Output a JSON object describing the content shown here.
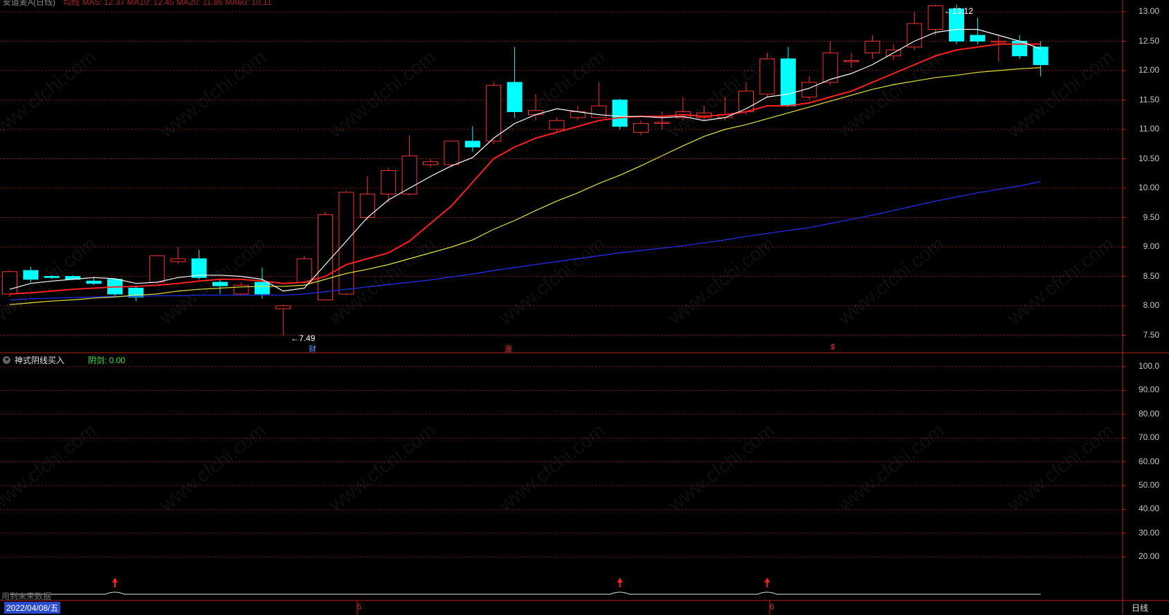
{
  "header": {
    "title": "安道麦A(日线)",
    "ma_legend": "均线   MA5: 12.37  MA10: 12.45  MA20: 11.86  MA60: 10.11"
  },
  "price_axis": {
    "ticks": [
      "13.00",
      "12.50",
      "12.00",
      "11.50",
      "11.00",
      "10.50",
      "10.00",
      "9.50",
      "9.00",
      "8.50",
      "8.00",
      "7.50"
    ],
    "min": 7.2,
    "max": 13.2
  },
  "indicator": {
    "name": "神式阴线买入",
    "value_label": "阴剑: 0.00",
    "axis_ticks": [
      "100.0",
      "90.00",
      "80.00",
      "70.00",
      "60.00",
      "50.00",
      "40.00",
      "30.00",
      "20.00"
    ],
    "future_note": "用到未来数据"
  },
  "extremes": {
    "high": "13.12",
    "low": "7.49"
  },
  "event_markers": [
    {
      "label": "财",
      "color": "#4aa0ff"
    },
    {
      "label": "涨",
      "color": "#ff3030"
    },
    {
      "label": "$",
      "color": "#ff3030"
    }
  ],
  "footer": {
    "date": "2022/04/08/五",
    "month_ticks": [
      "5",
      "6"
    ],
    "period": "日线"
  },
  "watermark": "www.cfchi.com",
  "colors": {
    "up": "#ff3030",
    "down": "#00ffff",
    "ma5": "#ffffff",
    "ma10": "#ff2020",
    "ma20": "#e6e63a",
    "ma60": "#2030ff",
    "grid": "#8b1010"
  },
  "chart_data": {
    "type": "candlestick",
    "ohlc": [
      [
        8.2,
        8.6,
        8.58,
        8.15
      ],
      [
        8.6,
        8.66,
        8.45,
        8.4
      ],
      [
        8.5,
        8.52,
        8.48,
        8.46
      ],
      [
        8.5,
        8.52,
        8.45,
        8.44
      ],
      [
        8.42,
        8.48,
        8.38,
        8.35
      ],
      [
        8.45,
        8.46,
        8.2,
        8.15
      ],
      [
        8.3,
        8.32,
        8.15,
        8.08
      ],
      [
        8.4,
        8.85,
        8.85,
        8.38
      ],
      [
        8.75,
        9.0,
        8.8,
        8.72
      ],
      [
        8.8,
        8.95,
        8.48,
        8.45
      ],
      [
        8.4,
        8.45,
        8.34,
        8.2
      ],
      [
        8.2,
        8.4,
        8.35,
        8.18
      ],
      [
        8.4,
        8.65,
        8.2,
        8.12
      ],
      [
        7.95,
        8.02,
        8.0,
        7.49
      ],
      [
        8.4,
        8.85,
        8.8,
        8.38
      ],
      [
        8.1,
        9.6,
        9.55,
        8.1
      ],
      [
        8.2,
        9.95,
        9.93,
        8.18
      ],
      [
        9.5,
        10.2,
        9.9,
        9.45
      ],
      [
        9.9,
        10.35,
        10.3,
        9.75
      ],
      [
        9.9,
        10.9,
        10.55,
        9.88
      ],
      [
        10.4,
        10.5,
        10.45,
        10.35
      ],
      [
        10.4,
        10.8,
        10.8,
        10.35
      ],
      [
        10.8,
        11.05,
        10.7,
        10.62
      ],
      [
        10.8,
        11.8,
        11.75,
        10.75
      ],
      [
        11.8,
        12.4,
        11.3,
        11.2
      ],
      [
        11.25,
        11.6,
        11.32,
        11.15
      ],
      [
        11.0,
        11.2,
        11.15,
        10.95
      ],
      [
        11.2,
        11.4,
        11.3,
        11.15
      ],
      [
        11.2,
        11.8,
        11.4,
        11.2
      ],
      [
        11.5,
        11.52,
        11.05,
        11.0
      ],
      [
        10.95,
        11.15,
        11.1,
        10.9
      ],
      [
        11.1,
        11.3,
        11.12,
        11.0
      ],
      [
        11.2,
        11.55,
        11.3,
        11.15
      ],
      [
        11.2,
        11.4,
        11.28,
        11.15
      ],
      [
        11.2,
        11.55,
        11.25,
        11.15
      ],
      [
        11.3,
        11.8,
        11.65,
        11.25
      ],
      [
        11.6,
        12.3,
        12.2,
        11.55
      ],
      [
        12.2,
        12.4,
        11.4,
        11.38
      ],
      [
        11.55,
        11.9,
        11.8,
        11.5
      ],
      [
        11.8,
        12.5,
        12.3,
        11.75
      ],
      [
        12.15,
        12.3,
        12.17,
        12.05
      ],
      [
        12.3,
        12.6,
        12.5,
        12.2
      ],
      [
        12.25,
        12.45,
        12.35,
        12.18
      ],
      [
        12.4,
        13.0,
        12.8,
        12.35
      ],
      [
        12.7,
        13.12,
        13.1,
        12.6
      ],
      [
        13.05,
        13.12,
        12.5,
        12.45
      ],
      [
        12.6,
        12.9,
        12.5,
        12.45
      ],
      [
        12.5,
        12.6,
        12.5,
        12.15
      ],
      [
        12.5,
        12.6,
        12.25,
        12.2
      ],
      [
        12.4,
        12.5,
        12.1,
        11.9
      ]
    ],
    "ma5": [
      8.28,
      8.38,
      8.42,
      8.45,
      8.48,
      8.46,
      8.38,
      8.4,
      8.48,
      8.52,
      8.52,
      8.5,
      8.45,
      8.25,
      8.3,
      8.7,
      9.1,
      9.5,
      9.8,
      10.0,
      10.2,
      10.38,
      10.52,
      10.85,
      11.1,
      11.25,
      11.35,
      11.3,
      11.25,
      11.22,
      11.22,
      11.2,
      11.22,
      11.15,
      11.2,
      11.35,
      11.55,
      11.6,
      11.7,
      11.85,
      11.95,
      12.1,
      12.3,
      12.5,
      12.65,
      12.7,
      12.7,
      12.6,
      12.5,
      12.37
    ],
    "ma10": [
      8.2,
      8.22,
      8.25,
      8.28,
      8.3,
      8.32,
      8.33,
      8.35,
      8.38,
      8.42,
      8.45,
      8.45,
      8.42,
      8.38,
      8.4,
      8.5,
      8.7,
      8.8,
      8.9,
      9.1,
      9.4,
      9.7,
      10.1,
      10.5,
      10.7,
      10.85,
      10.95,
      11.05,
      11.15,
      11.2,
      11.22,
      11.22,
      11.25,
      11.22,
      11.25,
      11.3,
      11.4,
      11.4,
      11.45,
      11.55,
      11.65,
      11.8,
      11.95,
      12.1,
      12.25,
      12.35,
      12.4,
      12.45,
      12.45,
      12.45
    ],
    "ma20": [
      8.02,
      8.05,
      8.08,
      8.1,
      8.13,
      8.15,
      8.18,
      8.2,
      8.25,
      8.28,
      8.3,
      8.32,
      8.33,
      8.33,
      8.35,
      8.45,
      8.55,
      8.62,
      8.7,
      8.8,
      8.9,
      9.0,
      9.12,
      9.3,
      9.45,
      9.62,
      9.78,
      9.92,
      10.08,
      10.22,
      10.38,
      10.55,
      10.72,
      10.88,
      11.0,
      11.08,
      11.18,
      11.28,
      11.38,
      11.48,
      11.58,
      11.68,
      11.76,
      11.82,
      11.88,
      11.92,
      11.97,
      12.0,
      12.03,
      12.05
    ],
    "ma60": [
      8.1,
      8.12,
      8.13,
      8.14,
      8.15,
      8.16,
      8.16,
      8.17,
      8.17,
      8.18,
      8.18,
      8.18,
      8.18,
      8.18,
      8.2,
      8.24,
      8.28,
      8.32,
      8.36,
      8.4,
      8.44,
      8.49,
      8.54,
      8.6,
      8.65,
      8.7,
      8.75,
      8.8,
      8.85,
      8.9,
      8.94,
      8.98,
      9.02,
      9.07,
      9.12,
      9.18,
      9.23,
      9.28,
      9.33,
      9.4,
      9.47,
      9.54,
      9.62,
      9.7,
      9.78,
      9.85,
      9.92,
      9.98,
      10.04,
      10.11
    ],
    "signal_bars": [
      5,
      29,
      36
    ],
    "ylim": [
      7.2,
      13.2
    ]
  }
}
